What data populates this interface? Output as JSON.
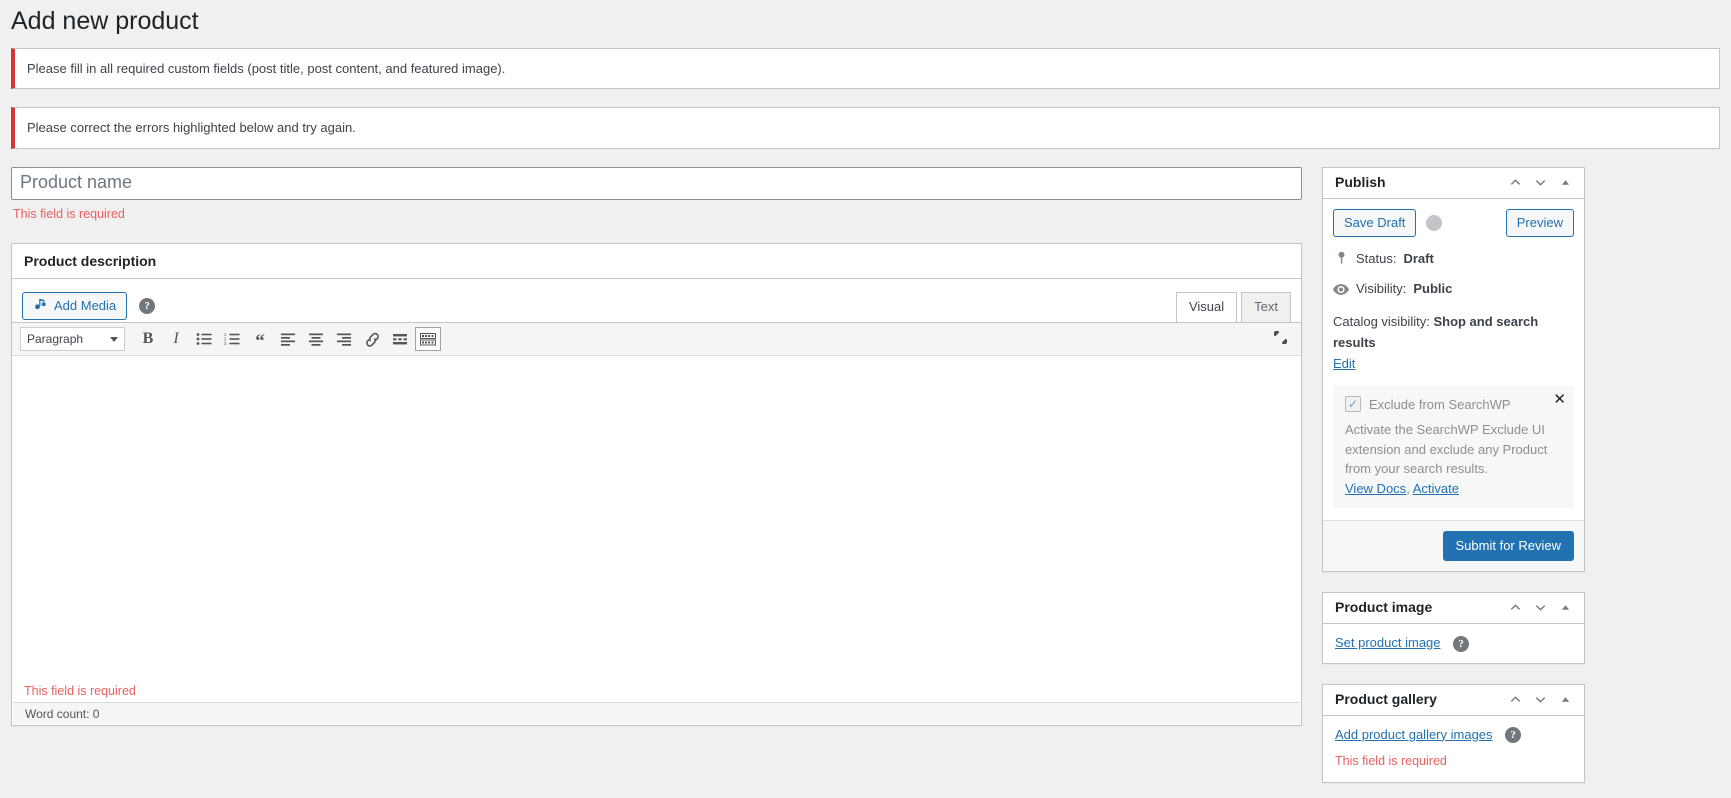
{
  "page": {
    "title": "Add new product"
  },
  "notices": [
    {
      "text": "Please fill in all required custom fields (post title, post content, and featured image)."
    },
    {
      "text": "Please correct the errors highlighted below and try again."
    }
  ],
  "title_field": {
    "placeholder": "Product name",
    "value": "",
    "error": "This field is required"
  },
  "editor": {
    "heading": "Product description",
    "add_media_label": "Add Media",
    "help_icon": "help-icon",
    "tabs": [
      {
        "label": "Visual",
        "active": true
      },
      {
        "label": "Text",
        "active": false
      }
    ],
    "format_select": "Paragraph",
    "toolbar_buttons": [
      "bold-icon",
      "italic-icon",
      "bulleted-list-icon",
      "numbered-list-icon",
      "blockquote-icon",
      "align-left-icon",
      "align-center-icon",
      "align-right-icon",
      "link-icon",
      "read-more-icon",
      "toolbar-toggle-icon"
    ],
    "fullscreen_icon": "fullscreen-icon",
    "content": "",
    "error": "This field is required",
    "word_count": "Word count: 0"
  },
  "publish": {
    "title": "Publish",
    "save_draft_label": "Save Draft",
    "preview_label": "Preview",
    "status_label": "Status:",
    "status_value": "Draft",
    "visibility_label": "Visibility:",
    "visibility_value": "Public",
    "catalog_label": "Catalog visibility:",
    "catalog_value": "Shop and search results",
    "catalog_edit_label": "Edit",
    "searchwp": {
      "checkbox_label": "Exclude from SearchWP",
      "description": "Activate the SearchWP Exclude UI extension and exclude any Product from your search results.",
      "view_docs_label": "View Docs",
      "separator": ", ",
      "activate_label": "Activate",
      "close_icon": "close-icon"
    },
    "submit_label": "Submit for Review"
  },
  "product_image": {
    "title": "Product image",
    "set_link_label": "Set product image"
  },
  "product_gallery": {
    "title": "Product gallery",
    "add_link_label": "Add product gallery images",
    "error": "This field is required"
  },
  "colors": {
    "accent": "#2271b1",
    "error": "#d63638",
    "error_text": "#e8615f",
    "background": "#f0f0f1"
  }
}
